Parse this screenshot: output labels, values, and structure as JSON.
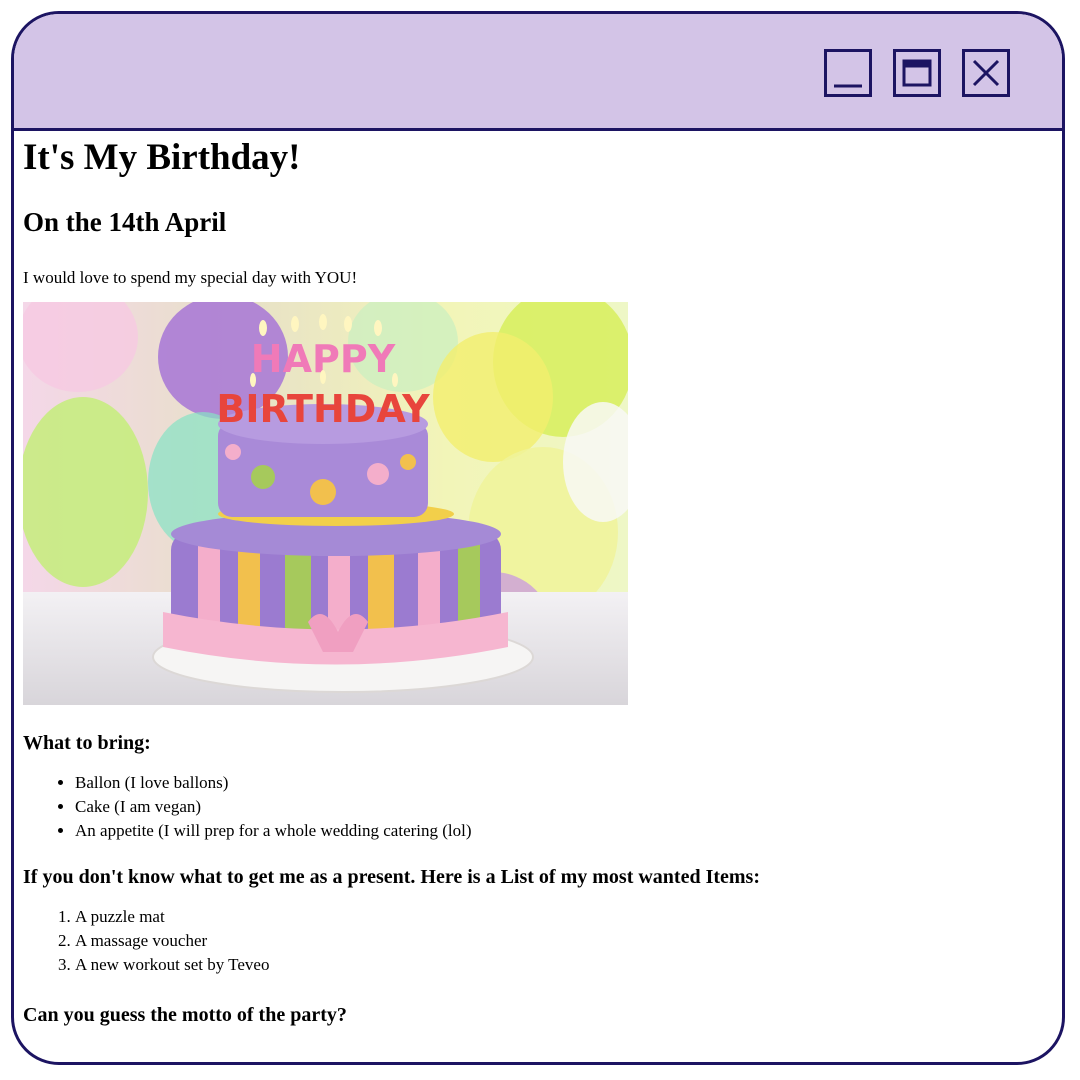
{
  "window": {
    "controls": {
      "minimize_icon": "minimize-icon",
      "maximize_icon": "maximize-icon",
      "close_icon": "close-icon"
    },
    "colors": {
      "titlebar": "#d3c4e7",
      "border": "#1c1462"
    }
  },
  "page": {
    "title": "It's My Birthday!",
    "date_heading": "On the 14th April",
    "intro": "I would love to spend my special day with YOU!",
    "cake_image_text": [
      "HAPPY",
      "BIRTHDAY"
    ],
    "bring_heading": "What to bring:",
    "bring_items": [
      "Ballon (I love ballons)",
      "Cake (I am vegan)",
      "An appetite (I will prep for a whole wedding catering (lol)"
    ],
    "present_heading": "If you don't know what to get me as a present. Here is a List of my most wanted Items:",
    "present_items": [
      "A puzzle mat",
      "A massage voucher",
      "A new workout set by Teveo"
    ],
    "motto_heading": "Can you guess the motto of the party?"
  }
}
